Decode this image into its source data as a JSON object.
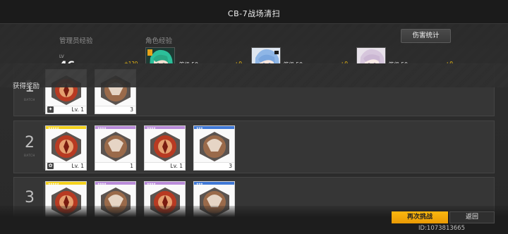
{
  "header": {
    "title": "CB-7战场清扫"
  },
  "exp_section": {
    "commander_label": "管理员经验",
    "character_label": "角色经验",
    "damage_stats_label": "伤害统计",
    "lv_tag": "LV",
    "commander_level": "46",
    "commander_exp_gain": "+120",
    "commander_exp_progress": 0.62,
    "characters": [
      {
        "level_text": "等级 50",
        "exp_gain": "+0",
        "portrait": "green-hair-girl-portrait",
        "progress": 1.0
      },
      {
        "level_text": "等级 50",
        "exp_gain": "+0",
        "portrait": "blue-hair-girl-portrait",
        "progress": 1.0
      },
      {
        "level_text": "等级 50",
        "exp_gain": "+0",
        "portrait": "silver-hair-girl-portrait",
        "progress": 1.0
      }
    ]
  },
  "rewards": {
    "label": "获得奖励",
    "batch_sublabel": "BATCH",
    "batches": [
      {
        "number": "1",
        "items": [
          {
            "caption": "Lv. 1",
            "rarity": "gold",
            "type": "gear-red",
            "badge": "chip"
          },
          {
            "caption": "3",
            "rarity": "purple",
            "type": "gear-bronze"
          }
        ]
      },
      {
        "number": "2",
        "items": [
          {
            "caption": "Lv. 1",
            "rarity": "gold",
            "stars": "★★★★★",
            "type": "gear-red",
            "badge": "flower"
          },
          {
            "caption": "1",
            "rarity": "purple",
            "stars": "★★★★",
            "type": "gear-bronze"
          },
          {
            "caption": "Lv. 1",
            "rarity": "purple",
            "stars": "★★★★",
            "type": "gear-red"
          },
          {
            "caption": "3",
            "rarity": "blue",
            "stars": "★★★",
            "type": "gear-bronze"
          }
        ]
      },
      {
        "number": "3",
        "items": [
          {
            "caption": "",
            "rarity": "gold",
            "stars": "★★★★★",
            "type": "gear-red"
          },
          {
            "caption": "",
            "rarity": "purple",
            "stars": "★★★★",
            "type": "gear-bronze"
          },
          {
            "caption": "",
            "rarity": "purple",
            "stars": "★★★★",
            "type": "gear-red"
          },
          {
            "caption": "",
            "rarity": "blue",
            "stars": "★★★",
            "type": "gear-bronze"
          }
        ]
      }
    ]
  },
  "footer": {
    "again_label": "再次挑战",
    "back_label": "返回",
    "uid": "ID:1073813665"
  },
  "colors": {
    "accent": "#f3c012",
    "gold": "#f4d21c",
    "purple": "#b98bd9",
    "blue": "#3f78d6",
    "button_orange": "#f4a90c"
  }
}
